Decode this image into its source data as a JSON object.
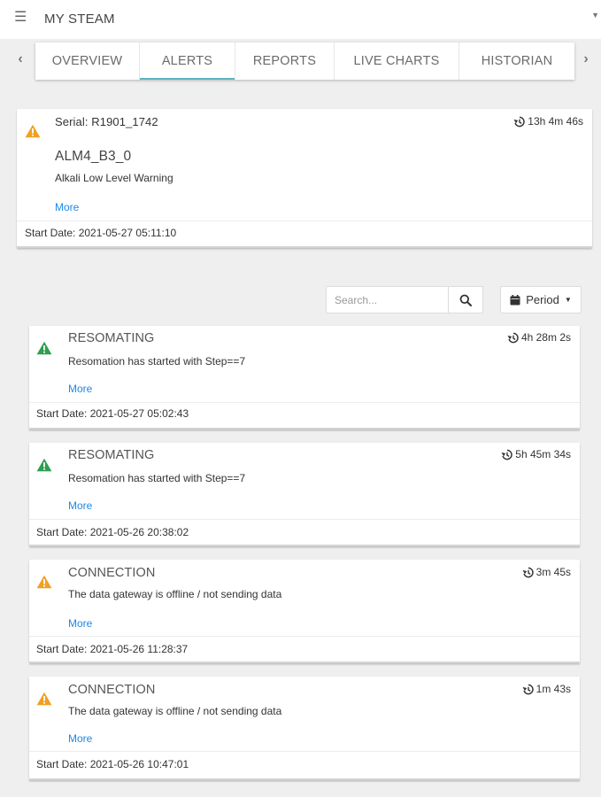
{
  "app": {
    "title": "MY STEAM"
  },
  "tabs": [
    {
      "label": "OVERVIEW",
      "active": false
    },
    {
      "label": "ALERTS",
      "active": true
    },
    {
      "label": "REPORTS",
      "active": false
    },
    {
      "label": "LIVE CHARTS",
      "active": false
    },
    {
      "label": "HISTORIAN",
      "active": false
    }
  ],
  "featured_alert": {
    "icon": "warning-triangle-orange",
    "serial": "Serial: R1901_1742",
    "duration": "13h 4m 46s",
    "code": "ALM4_B3_0",
    "description": "Alkali Low Level Warning",
    "more_label": "More",
    "start_date": "Start Date: 2021-05-27 05:11:10"
  },
  "filters": {
    "search_placeholder": "Search...",
    "period_label": "Period"
  },
  "alerts": [
    {
      "icon": "warning-triangle-green",
      "title": "RESOMATING",
      "duration": "4h 28m 2s",
      "description": "Resomation has started with Step==7",
      "more_label": "More",
      "start_date": "Start Date: 2021-05-27 05:02:43"
    },
    {
      "icon": "warning-triangle-green",
      "title": "RESOMATING",
      "duration": "5h 45m 34s",
      "description": "Resomation has started with Step==7",
      "more_label": "More",
      "start_date": "Start Date: 2021-05-26 20:38:02"
    },
    {
      "icon": "warning-triangle-orange",
      "title": "CONNECTION",
      "duration": "3m 45s",
      "description": "The data gateway is offline / not sending data",
      "more_label": "More",
      "start_date": "Start Date: 2021-05-26 11:28:37"
    },
    {
      "icon": "warning-triangle-orange",
      "title": "CONNECTION",
      "duration": "1m 43s",
      "description": "The data gateway is offline / not sending data",
      "more_label": "More",
      "start_date": "Start Date: 2021-05-26 10:47:01"
    }
  ],
  "colors": {
    "warning_orange": "#f0a020",
    "success_green": "#2e9e4f",
    "link_blue": "#1e88e5",
    "tab_underline": "#5fb3c4"
  }
}
